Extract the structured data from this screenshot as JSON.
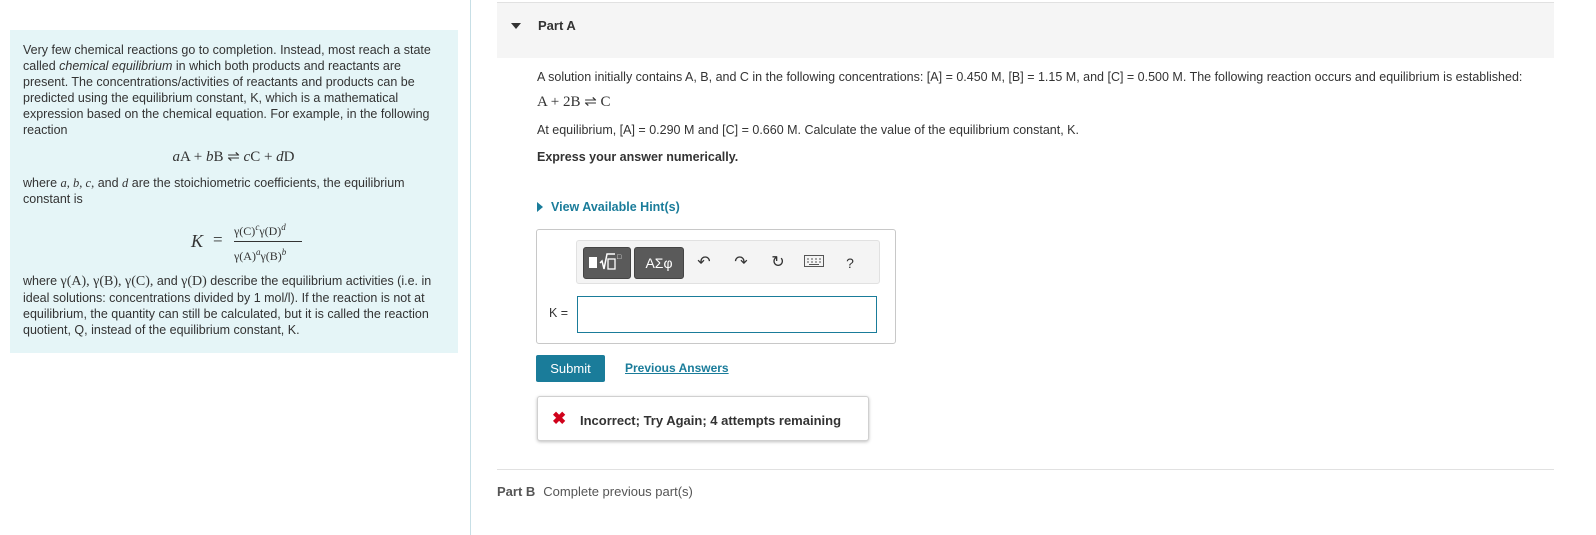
{
  "intro": {
    "p1_a": "Very few chemical reactions go to completion. Instead, most reach a state called ",
    "p1_em": "chemical equilibrium",
    "p1_b": " in which both products and reactants are present. The concentrations/activities of reactants and products can be predicted using the equilibrium constant, K, which is a mathematical expression based on the chemical equation. For example, in the following reaction",
    "p2_a": "where ",
    "p2_b": " are the stoichiometric coefficients, the equilibrium constant is",
    "p3_a": "where ",
    "p3_b": " describe the equilibrium activities (i.e. in ideal solutions: concentrations divided by 1 mol/l). If the reaction is not at equilibrium, the quantity can still be calculated, but it is called the reaction quotient, Q, instead of the equilibrium constant, K."
  },
  "part_a": {
    "title": "Part A",
    "q1": "A solution initially contains A, B, and C in the following concentrations: [A] = 0.450 M, [B] = 1.15 M, and [C] = 0.500 M. The following reaction occurs and equilibrium is established:",
    "reaction": "A + 2B ⇌ C",
    "q2": "At equilibrium, [A] = 0.290 M and [C] = 0.660 M. Calculate the value of the equilibrium constant, K.",
    "express": "Express your answer numerically.",
    "hint_link": "View Available Hint(s)",
    "k_label": "K =",
    "input_value": "",
    "submit_label": "Submit",
    "previous_answers": "Previous Answers",
    "feedback": "Incorrect; Try Again; 4 attempts remaining"
  },
  "toolbar": {
    "greek_label": "ΑΣφ",
    "help_label": "?"
  },
  "part_b": {
    "title": "Part B",
    "status": "Complete previous part(s)"
  },
  "colors": {
    "accent": "#1a7c9a",
    "panel_bg": "#e5f5f7",
    "error": "#d0021b"
  }
}
